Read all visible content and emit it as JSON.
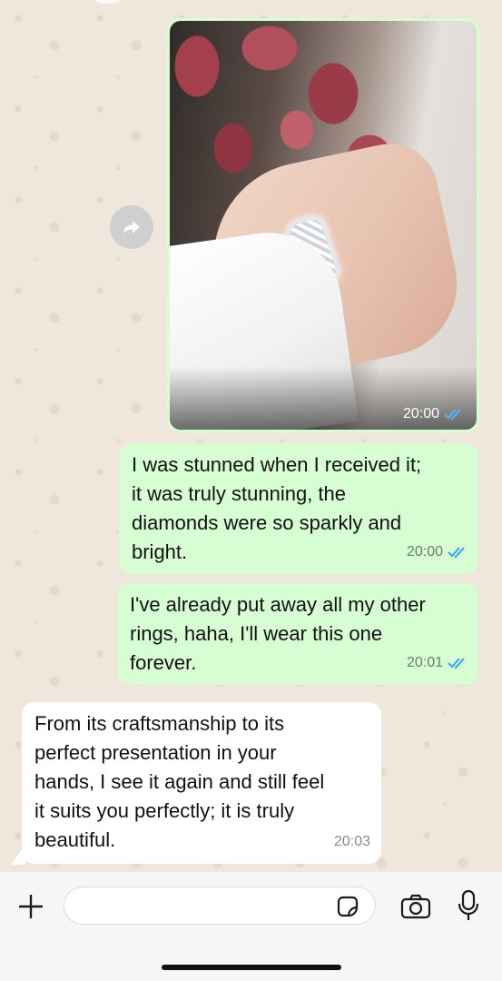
{
  "chat": {
    "photo_message": {
      "time": "20:00",
      "status": "read"
    },
    "messages": [
      {
        "direction": "outgoing",
        "text": "I was stunned when I received it;\nit was truly stunning, the\ndiamonds were so sparkly and\nbright.",
        "time": "20:00",
        "status": "read"
      },
      {
        "direction": "outgoing",
        "text": "I've already put away all my other\nrings, haha, I'll wear this one\nforever.",
        "time": "20:01",
        "status": "read"
      },
      {
        "direction": "incoming",
        "text": "From its craftsmanship to its\nperfect presentation in your\nhands, I see it again and still feel\nit suits you perfectly; it is truly\nbeautiful.",
        "time": "20:03"
      }
    ]
  },
  "input_bar": {
    "message_value": "",
    "icons": [
      "plus-icon",
      "sticker-icon",
      "camera-icon",
      "microphone-icon"
    ]
  },
  "colors": {
    "outgoing_bubble": "#d7fdd2",
    "incoming_bubble": "#ffffff",
    "read_tick": "#34a6f4",
    "chat_background": "#efe7dc"
  }
}
